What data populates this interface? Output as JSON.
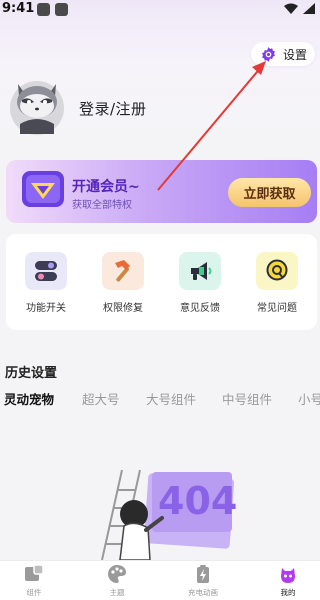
{
  "status_bar": {
    "time": "9:41"
  },
  "settings": {
    "label": "设置",
    "icon": "gear-icon"
  },
  "profile": {
    "login_label": "登录/注册",
    "avatar": "raccoon-avatar"
  },
  "vip": {
    "title": "开通会员~",
    "subtitle": "获取全部特权",
    "button": "立即获取",
    "colors": {
      "banner_start": "#f1dbfa",
      "banner_end": "#a57ef4",
      "button": "#f5c36d"
    }
  },
  "tools": [
    {
      "label": "功能开关",
      "icon": "toggle-switch-icon"
    },
    {
      "label": "权限修复",
      "icon": "hammer-icon"
    },
    {
      "label": "意见反馈",
      "icon": "megaphone-icon"
    },
    {
      "label": "常见问题",
      "icon": "question-bubble-icon"
    }
  ],
  "history": {
    "title": "历史设置",
    "tabs": [
      "灵动宠物",
      "超大号",
      "大号组件",
      "中号组件",
      "小号"
    ],
    "active_tab": "灵动宠物"
  },
  "empty_state": {
    "illustration": "404-ladder-illustration",
    "text": "404"
  },
  "bottom_nav": [
    {
      "label": "组件",
      "icon": "widget-icon"
    },
    {
      "label": "主题",
      "icon": "palette-icon"
    },
    {
      "label": "充电动画",
      "icon": "battery-charging-icon"
    },
    {
      "label": "我的",
      "icon": "profile-mascot-icon",
      "active": true
    }
  ],
  "colors": {
    "accent": "#7b3cf0",
    "annotation_arrow": "#e53935"
  }
}
